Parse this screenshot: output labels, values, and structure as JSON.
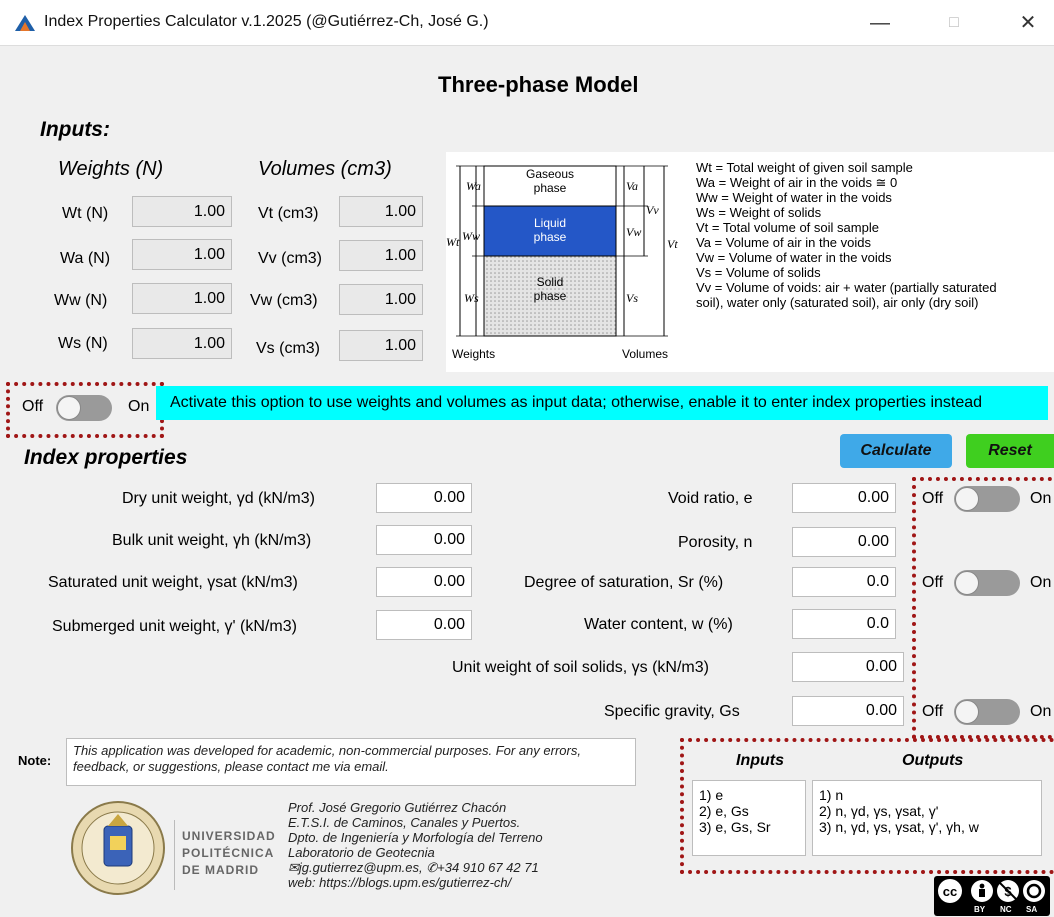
{
  "window": {
    "title": "Index Properties Calculator v.1.2025 (@Gutiérrez-Ch, José G.)"
  },
  "main_title": "Three-phase Model",
  "inputs": {
    "header": "Inputs:",
    "weights_header": "Weights (N)",
    "volumes_header": "Volumes (cm3)",
    "weights": [
      {
        "label": "Wt (N)",
        "value": "1.00"
      },
      {
        "label": "Wa (N)",
        "value": "1.00"
      },
      {
        "label": "Ww (N)",
        "value": "1.00"
      },
      {
        "label": "Ws (N)",
        "value": "1.00"
      }
    ],
    "volumes": [
      {
        "label": "Vt (cm3)",
        "value": "1.00"
      },
      {
        "label": "Vv (cm3)",
        "value": "1.00"
      },
      {
        "label": "Vw (cm3)",
        "value": "1.00"
      },
      {
        "label": "Vs (cm3)",
        "value": "1.00"
      }
    ]
  },
  "diagram": {
    "gaseous": [
      "Gaseous",
      "phase"
    ],
    "liquid": [
      "Liquid",
      "phase"
    ],
    "solid": [
      "Solid",
      "phase"
    ],
    "weights_label": "Weights",
    "volumes_label": "Volumes",
    "left_labels": [
      "Wa",
      "Ww",
      "Ws",
      "Wt"
    ],
    "right_labels": [
      "Va",
      "Vw",
      "Vs",
      "Vv",
      "Vt"
    ],
    "legend": [
      "Wt = Total weight of given soil sample",
      "Wa = Weight of air in the voids ≅ 0",
      "Ww = Weight of water in the voids",
      "Ws = Weight of solids",
      "Vt = Total volume of soil sample",
      "Va = Volume of air in the voids",
      "Vw = Volume of water in the voids",
      "Vs = Volume of solids",
      "Vv = Volume of voids: air + water (partially saturated",
      "soil), water only (saturated soil), air only (dry soil)"
    ],
    "legend_symbols": [
      "Wt",
      "Wa",
      "Ww",
      "Ws",
      "Vt",
      "Va",
      "Vw",
      "Vs",
      "Vv",
      ""
    ]
  },
  "mode_toggle": {
    "off": "Off",
    "on": "On",
    "message": "Activate this option to use weights and volumes as input data; otherwise, enable it to enter index properties instead"
  },
  "index": {
    "header": "Index properties",
    "calculate": "Calculate",
    "reset": "Reset",
    "left": [
      {
        "label": "Dry unit weight, γd (kN/m3)",
        "value": "0.00"
      },
      {
        "label": "Bulk unit weight, γh (kN/m3)",
        "value": "0.00"
      },
      {
        "label": "Saturated unit weight, γsat (kN/m3)",
        "value": "0.00"
      },
      {
        "label": "Submerged unit weight, γ' (kN/m3)",
        "value": "0.00"
      }
    ],
    "right": [
      {
        "label": "Void ratio, e",
        "value": "0.00"
      },
      {
        "label": "Porosity, n",
        "value": "0.00"
      },
      {
        "label": "Degree of saturation, Sr (%)",
        "value": "0.0"
      },
      {
        "label": "Water content, w (%)",
        "value": "0.0"
      },
      {
        "label": "Unit weight of soil solids, γs (kN/m3)",
        "value": "0.00"
      },
      {
        "label": "Specific gravity, Gs",
        "value": "0.00"
      }
    ],
    "toggle_off": "Off",
    "toggle_on": "On"
  },
  "note": {
    "label": "Note:",
    "text": "This application was developed for academic, non-commercial purposes. For any errors, feedback, or suggestions, please contact me via email."
  },
  "io_table": {
    "inputs_header": "Inputs",
    "outputs_header": "Outputs",
    "inputs": [
      "1) e",
      "2) e, Gs",
      "3) e, Gs, Sr"
    ],
    "outputs": [
      "1) n",
      "2) n, γd, γs, γsat, γ'",
      "3) n, γd, γs, γsat, γ', γh, w"
    ]
  },
  "university": {
    "line1": "UNIVERSIDAD",
    "line2": "POLITÉCNICA",
    "line3": "DE MADRID"
  },
  "credits": [
    "Prof. José Gregorio Gutiérrez Chacón",
    "E.T.S.I. de Caminos, Canales y Puertos.",
    "Dpto. de Ingeniería y Morfología del Terreno",
    "Laboratorio de Geotecnia",
    "✉jg.gutierrez@upm.es, ✆+34 910 67 42 71",
    "web: https://blogs.upm.es/gutierrez-ch/"
  ],
  "license": {
    "by": "BY",
    "nc": "NC",
    "sa": "SA"
  },
  "colors": {
    "calculate": "#3fa9e8",
    "reset": "#3fcf1f",
    "banner": "#00ffff",
    "dash": "#a01616"
  }
}
